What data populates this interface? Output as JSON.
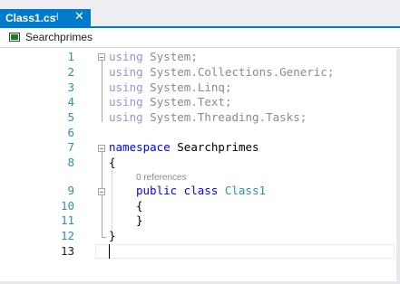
{
  "tab": {
    "title": "Class1.cs",
    "pin_glyph": "⊣",
    "close_glyph": "✕"
  },
  "navbar": {
    "icon": "csharp-class-icon",
    "label": "Searchprimes"
  },
  "editor": {
    "line_numbers": [
      "1",
      "2",
      "3",
      "4",
      "5",
      "6",
      "7",
      "8",
      "9",
      "10",
      "11",
      "12",
      "13"
    ],
    "usings": {
      "keyword": "using",
      "namespaces": [
        "System;",
        "System.Collections.Generic;",
        "System.Linq;",
        "System.Text;",
        "System.Threading.Tasks;"
      ]
    },
    "namespace_keyword": "namespace",
    "namespace_name": "Searchprimes",
    "open_brace": "{",
    "close_brace": "}",
    "codelens": "0 references",
    "class_modifiers": "public class",
    "class_name": "Class1"
  },
  "colors": {
    "accent": "#007acc",
    "keyword": "#0000ff",
    "type": "#2b91af",
    "line_number": "#2b91af"
  }
}
